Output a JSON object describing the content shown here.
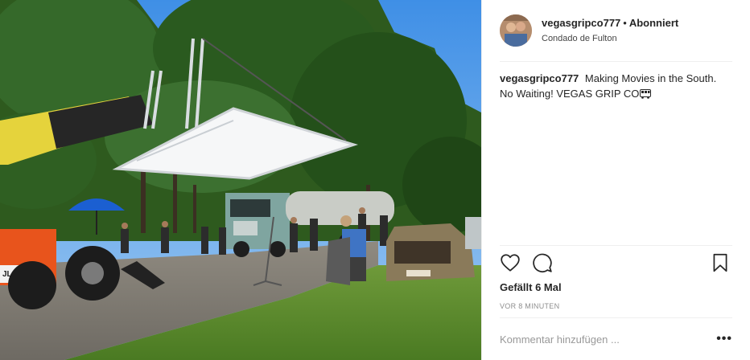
{
  "post": {
    "image": {
      "description_icon": "photo"
    },
    "header": {
      "username": "vegasgripco777",
      "separator": "•",
      "follow_status": "Abonniert",
      "location": "Condado de Fulton",
      "avatar_icon": "profile-avatar"
    },
    "caption": {
      "username": "vegasgripco777",
      "text": "Making Movies in the South. No Waiting! VEGAS GRIP CO",
      "emoji_icon": "bus-icon"
    },
    "actions": {
      "like_icon": "heart-icon",
      "comment_icon": "comment-icon",
      "save_icon": "bookmark-icon"
    },
    "likes": "Gefällt 6 Mal",
    "timestamp": "VOR 8 MINUTEN",
    "comment_box": {
      "placeholder": "Kommentar hinzufügen ...",
      "more": "•••"
    },
    "colors": {
      "text": "#262626",
      "muted": "#8e8e8e",
      "border": "#efefef"
    }
  }
}
